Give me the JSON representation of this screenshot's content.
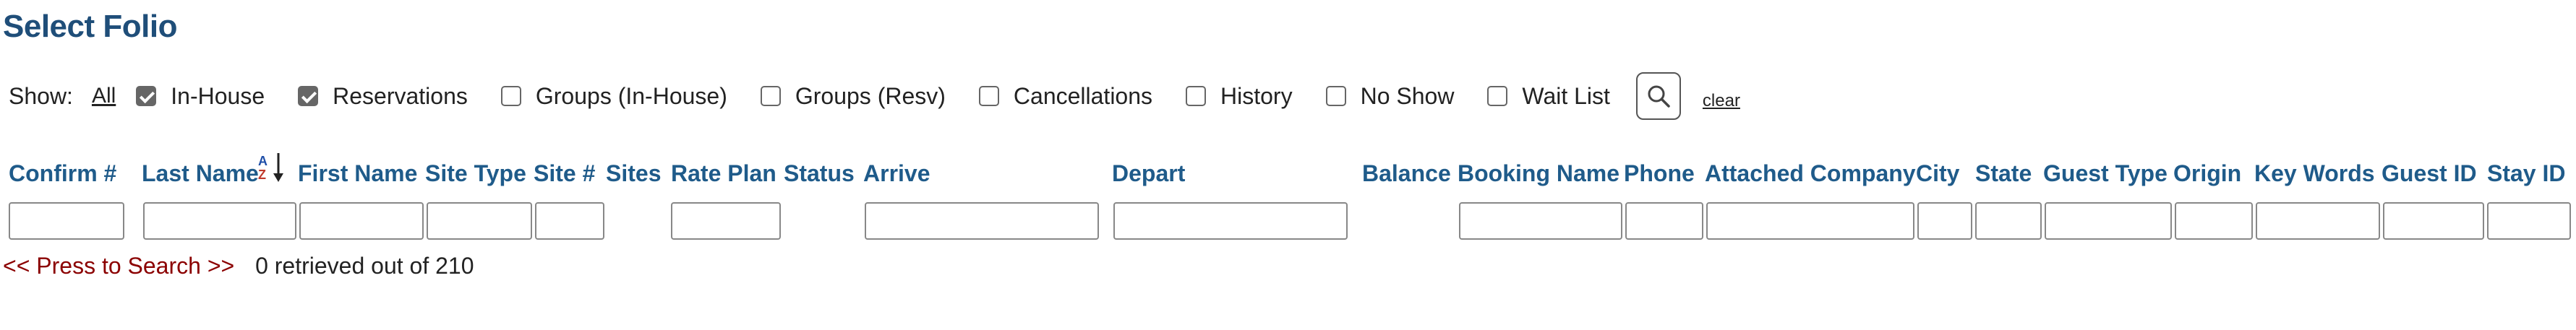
{
  "page": {
    "title": "Select Folio"
  },
  "filters": {
    "show_label": "Show:",
    "all_label": "All",
    "options": [
      {
        "label": "In-House",
        "checked": true
      },
      {
        "label": "Reservations",
        "checked": true
      },
      {
        "label": "Groups (In-House)",
        "checked": false
      },
      {
        "label": "Groups (Resv)",
        "checked": false
      },
      {
        "label": "Cancellations",
        "checked": false
      },
      {
        "label": "History",
        "checked": false
      },
      {
        "label": "No Show",
        "checked": false
      },
      {
        "label": "Wait List",
        "checked": false
      }
    ],
    "clear_label": "clear"
  },
  "columns": [
    "Confirm #",
    "Last Name",
    "First Name",
    "Site Type",
    "Site #",
    "Sites",
    "Rate Plan",
    "Status",
    "Arrive",
    "Depart",
    "Balance",
    "Booking Name",
    "Phone",
    "Attached Company",
    "City",
    "State",
    "Guest Type",
    "Origin",
    "Key Words",
    "Guest ID",
    "Stay ID"
  ],
  "search_inputs": {
    "confirm": "",
    "last_name": "",
    "first_name": "",
    "site_type": "",
    "site_num": "",
    "rate_plan": "",
    "arrive": "",
    "depart": "",
    "booking_name": "",
    "phone": "",
    "attached_company": "",
    "city": "",
    "state": "",
    "guest_type": "",
    "origin": "",
    "key_words": "",
    "guest_id": "",
    "stay_id": ""
  },
  "results": {
    "press_label": "<< Press to Search >>",
    "count_text": "0 retrieved out of 210"
  },
  "colors": {
    "heading": "#1f5b8a",
    "title": "#1f4e79",
    "link_red": "#8b0000"
  }
}
